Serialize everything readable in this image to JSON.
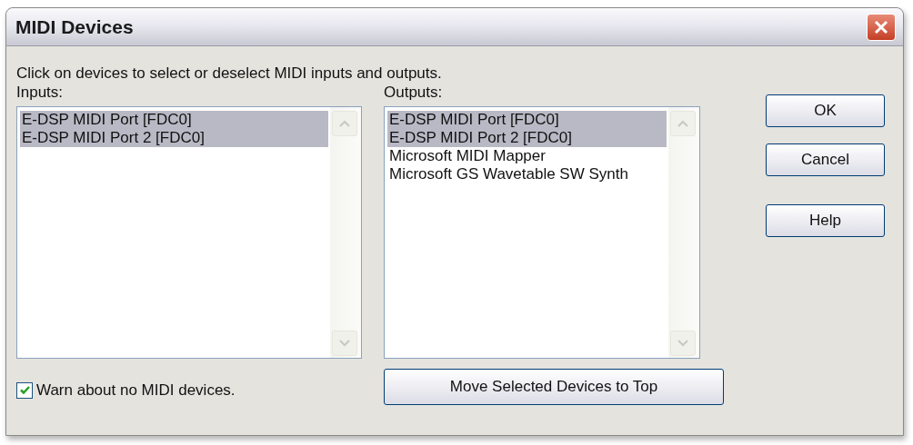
{
  "window": {
    "title": "MIDI Devices"
  },
  "instruction": "Click on devices to select or deselect MIDI inputs and outputs.",
  "inputs": {
    "label": "Inputs:",
    "items": [
      {
        "name": "E-DSP MIDI Port [FDC0]",
        "selected": true
      },
      {
        "name": "E-DSP MIDI Port 2 [FDC0]",
        "selected": true
      }
    ]
  },
  "outputs": {
    "label": "Outputs:",
    "items": [
      {
        "name": "E-DSP MIDI Port [FDC0]",
        "selected": true
      },
      {
        "name": "E-DSP MIDI Port 2 [FDC0]",
        "selected": true
      },
      {
        "name": "Microsoft MIDI Mapper",
        "selected": false
      },
      {
        "name": "Microsoft GS Wavetable SW Synth",
        "selected": false
      }
    ]
  },
  "warn_checkbox": {
    "label": "Warn about no MIDI devices.",
    "checked": true
  },
  "move_button": "Move Selected Devices to Top",
  "buttons": [
    "OK",
    "Cancel",
    "Help"
  ]
}
